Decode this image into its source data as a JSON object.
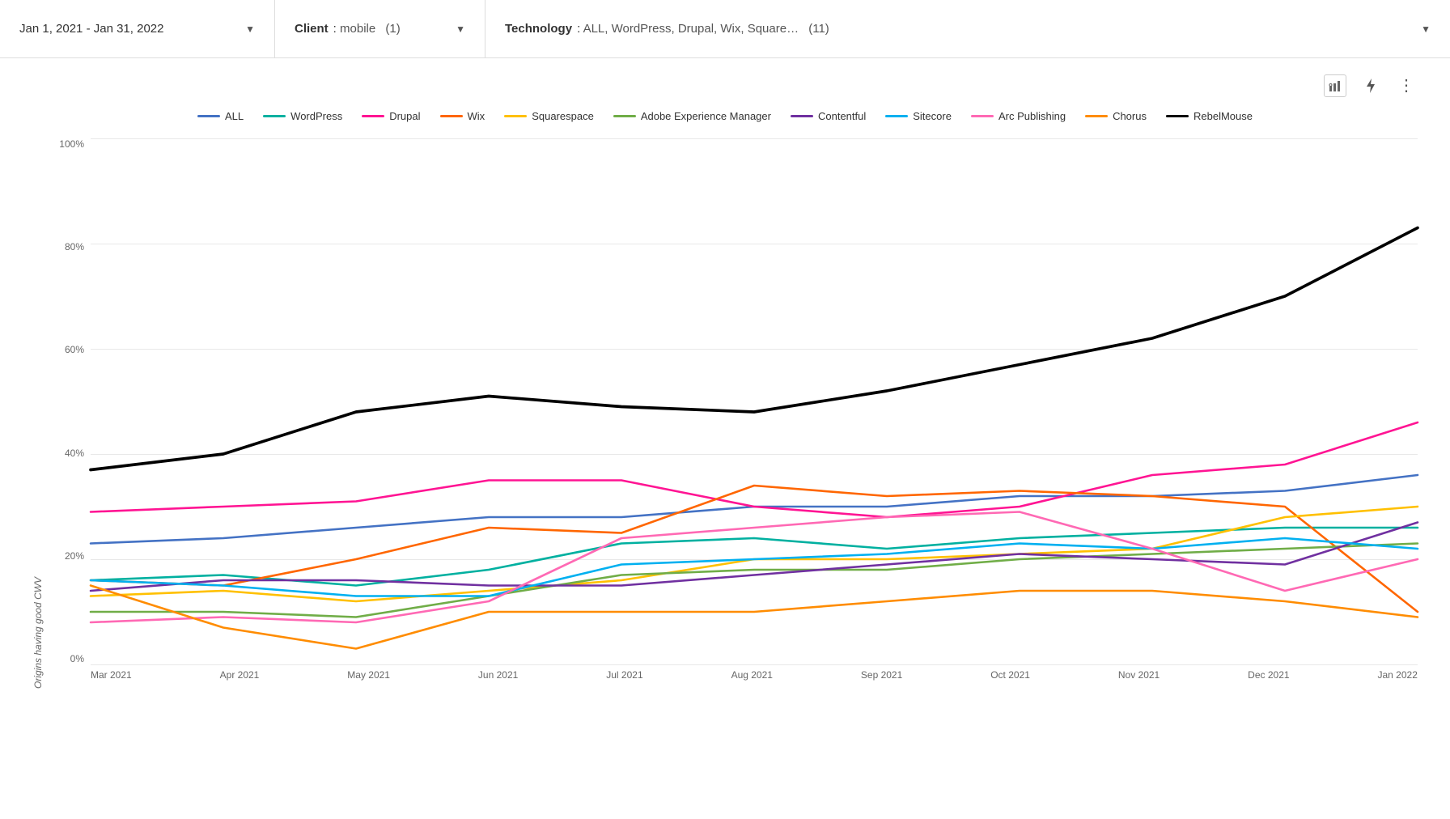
{
  "topbar": {
    "date_filter": {
      "value": "Jan 1, 2021 - Jan 31, 2022",
      "label": ""
    },
    "client_filter": {
      "label": "Client",
      "value": "mobile",
      "count": "(1)"
    },
    "tech_filter": {
      "label": "Technology",
      "value": "ALL, WordPress, Drupal, Wix, Square…",
      "count": "(11)"
    }
  },
  "chart": {
    "y_axis_label": "Origins having good CWV",
    "y_ticks": [
      "100%",
      "80%",
      "60%",
      "40%",
      "20%",
      "0%"
    ],
    "x_ticks": [
      "Mar 2021",
      "Apr 2021",
      "May 2021",
      "Jun 2021",
      "Jul 2021",
      "Aug 2021",
      "Sep 2021",
      "Oct 2021",
      "Nov 2021",
      "Dec 2021",
      "Jan 2022"
    ],
    "legend": [
      {
        "label": "ALL",
        "color": "#4472C4"
      },
      {
        "label": "WordPress",
        "color": "#00B0A0"
      },
      {
        "label": "Drupal",
        "color": "#FF1493"
      },
      {
        "label": "Wix",
        "color": "#FF6600"
      },
      {
        "label": "Squarespace",
        "color": "#FFC000"
      },
      {
        "label": "Adobe Experience Manager",
        "color": "#70AD47"
      },
      {
        "label": "Contentful",
        "color": "#7030A0"
      },
      {
        "label": "Sitecore",
        "color": "#00B0F0"
      },
      {
        "label": "Arc Publishing",
        "color": "#FF69B4"
      },
      {
        "label": "Chorus",
        "color": "#FF8C00"
      },
      {
        "label": "RebelMouse",
        "color": "#000000"
      }
    ]
  }
}
